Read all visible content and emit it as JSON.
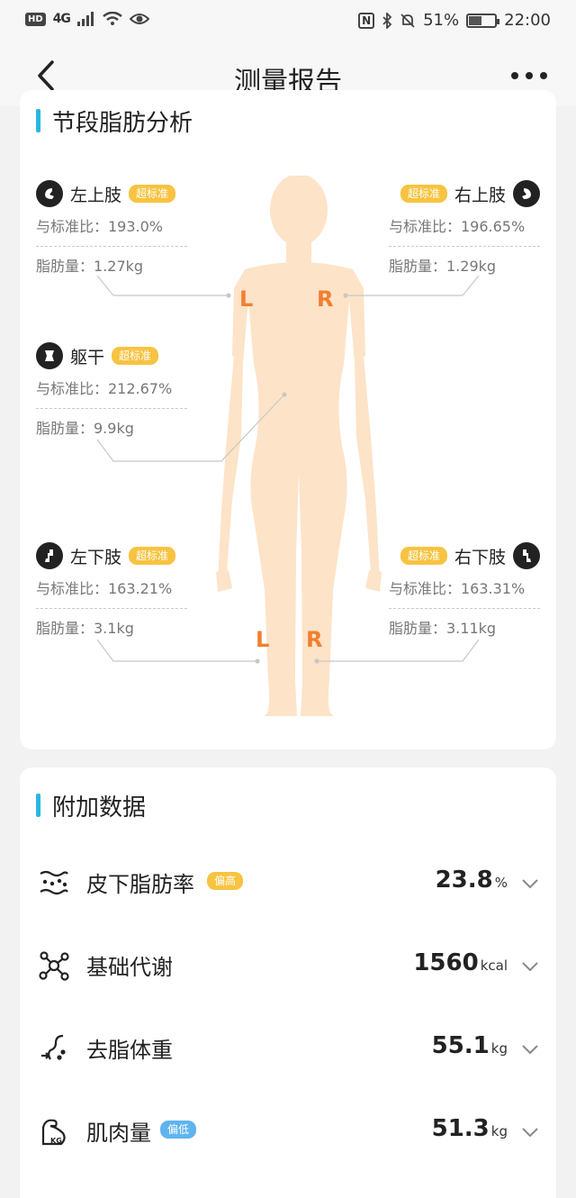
{
  "status": {
    "hd": "HD",
    "network": "4G",
    "battery_pct": "51%",
    "battery_level": 0.51,
    "time": "22:00"
  },
  "nav": {
    "title": "测量报告"
  },
  "segment_section": {
    "title": "节段脂肪分析",
    "segments": {
      "left_upper": {
        "name": "左上肢",
        "badge": "超标准",
        "ratio": "与标准比：193.0%",
        "fat": "脂肪量：1.27kg",
        "icon": "left-arm-icon"
      },
      "right_upper": {
        "name": "右上肢",
        "badge": "超标准",
        "ratio": "与标准比：196.65%",
        "fat": "脂肪量：1.29kg",
        "icon": "right-arm-icon"
      },
      "trunk": {
        "name": "躯干",
        "badge": "超标准",
        "ratio": "与标准比：212.67%",
        "fat": "脂肪量：9.9kg",
        "icon": "trunk-icon"
      },
      "left_lower": {
        "name": "左下肢",
        "badge": "超标准",
        "ratio": "与标准比：163.21%",
        "fat": "脂肪量：3.1kg",
        "icon": "left-leg-icon"
      },
      "right_lower": {
        "name": "右下肢",
        "badge": "超标准",
        "ratio": "与标准比：163.31%",
        "fat": "脂肪量：3.11kg",
        "icon": "right-leg-icon"
      }
    },
    "letters": {
      "upper_left": "L",
      "upper_right": "R",
      "lower_left": "L",
      "lower_right": "R"
    }
  },
  "extra_section": {
    "title": "附加数据",
    "items": [
      {
        "label": "皮下脂肪率",
        "badge": "偏高",
        "value": "23.8",
        "unit": "%",
        "icon": "subcutaneous-fat-icon"
      },
      {
        "label": "基础代谢",
        "badge": "",
        "value": "1560",
        "unit": "kcal",
        "icon": "metabolism-icon"
      },
      {
        "label": "去脂体重",
        "badge": "",
        "value": "55.1",
        "unit": "kg",
        "icon": "lean-mass-icon"
      },
      {
        "label": "肌肉量",
        "badge": "偏低",
        "value": "51.3",
        "unit": "kg",
        "icon": "muscle-icon"
      }
    ]
  },
  "colors": {
    "accent": "#2ab6e0",
    "badge_high": "#f7c341",
    "badge_low": "#5fb4ee",
    "body": "#fde3c8",
    "marker": "#f08030"
  }
}
